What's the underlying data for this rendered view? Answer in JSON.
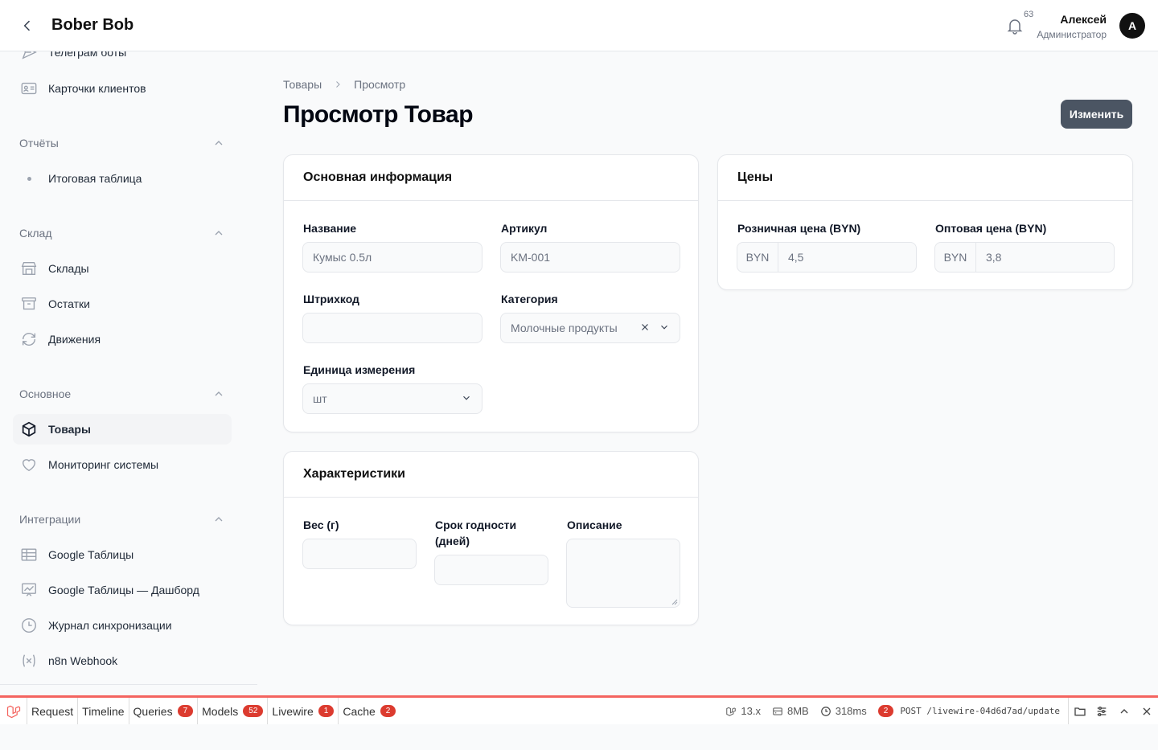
{
  "header": {
    "brand": "Bober Bob",
    "notifications_count": "63",
    "user_name": "Алексей",
    "user_role": "Администратор",
    "avatar_letter": "A"
  },
  "sidebar": {
    "items_top": [
      {
        "label": "Телеграм боты",
        "icon": "send-icon"
      },
      {
        "label": "Карточки клиентов",
        "icon": "id-card-icon"
      }
    ],
    "groups": [
      {
        "label": "Отчёты",
        "items": [
          {
            "label": "Итоговая таблица",
            "icon": "dot"
          }
        ]
      },
      {
        "label": "Склад",
        "items": [
          {
            "label": "Склады",
            "icon": "warehouse-icon"
          },
          {
            "label": "Остатки",
            "icon": "archive-box-icon"
          },
          {
            "label": "Движения",
            "icon": "refresh-icon"
          }
        ]
      },
      {
        "label": "Основное",
        "items": [
          {
            "label": "Товары",
            "icon": "cube-icon",
            "active": true
          },
          {
            "label": "Мониторинг системы",
            "icon": "heart-icon"
          }
        ]
      },
      {
        "label": "Интеграции",
        "items": [
          {
            "label": "Google Таблицы",
            "icon": "table-icon"
          },
          {
            "label": "Google Таблицы — Дашборд",
            "icon": "chart-icon"
          },
          {
            "label": "Журнал синхронизации",
            "icon": "clock-icon"
          },
          {
            "label": "n8n Webhook",
            "icon": "variable-icon"
          }
        ]
      }
    ]
  },
  "breadcrumb": {
    "parent": "Товары",
    "current": "Просмотр"
  },
  "page": {
    "title": "Просмотр Товар",
    "edit_button": "Изменить"
  },
  "main_info": {
    "title": "Основная информация",
    "name_label": "Название",
    "name_value": "Кумыс 0.5л",
    "sku_label": "Артикул",
    "sku_value": "KM-001",
    "barcode_label": "Штрихкод",
    "barcode_value": "",
    "category_label": "Категория",
    "category_value": "Молочные продукты",
    "unit_label": "Единица измерения",
    "unit_value": "шт"
  },
  "prices": {
    "title": "Цены",
    "retail_label": "Розничная цена (BYN)",
    "retail_prefix": "BYN",
    "retail_value": "4,5",
    "wholesale_label": "Оптовая цена (BYN)",
    "wholesale_prefix": "BYN",
    "wholesale_value": "3,8"
  },
  "specs": {
    "title": "Характеристики",
    "weight_label": "Вес (г)",
    "shelf_label_1": "Срок годности",
    "shelf_label_2": "(дней)",
    "description_label": "Описание"
  },
  "debugbar": {
    "tabs": [
      {
        "label": "Request"
      },
      {
        "label": "Timeline"
      },
      {
        "label": "Queries",
        "badge": "7"
      },
      {
        "label": "Models",
        "badge": "52"
      },
      {
        "label": "Livewire",
        "badge": "1"
      },
      {
        "label": "Cache",
        "badge": "2"
      }
    ],
    "version": "13.x",
    "memory": "8MB",
    "time": "318ms",
    "requests_badge": "2",
    "request_line": "POST /livewire-04d6d7ad/update"
  },
  "colors": {
    "accent_button": "#4b5563",
    "debugbar_accent": "#f4645f",
    "badge": "#dc3b2f"
  }
}
